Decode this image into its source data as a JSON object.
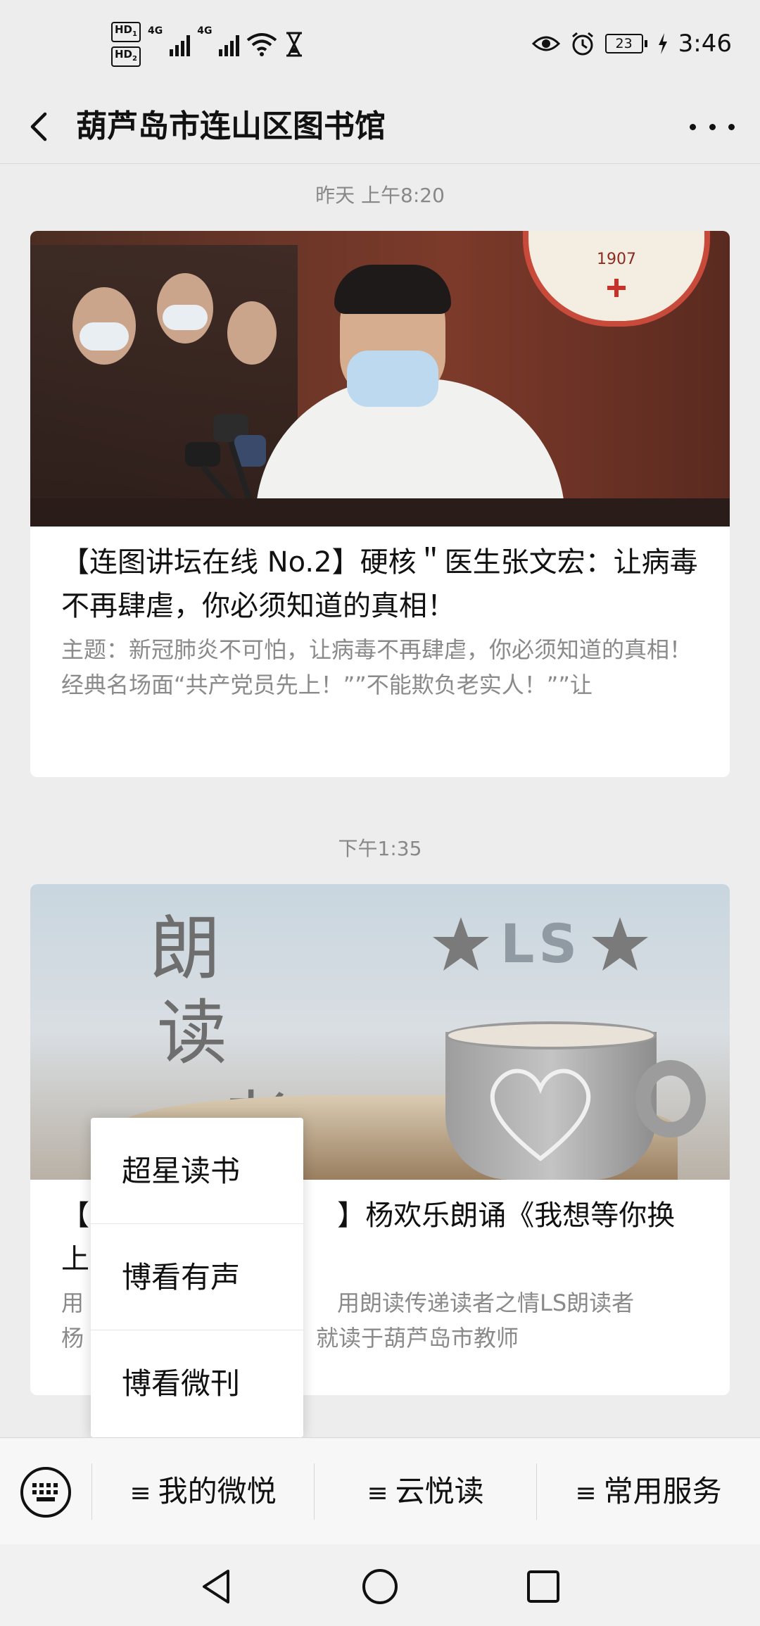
{
  "status_bar": {
    "hd1": "HD",
    "hd1_sub": "1",
    "hd2": "HD",
    "hd2_sub": "2",
    "net1": "4G",
    "net2": "4G",
    "battery": "23",
    "time": "3:46"
  },
  "header": {
    "title": "葫芦岛市连山区图书馆"
  },
  "messages": [
    {
      "time": "昨天 上午8:20",
      "title": "【连图讲坛在线 No.2】硬核＂医生张文宏：让病毒不再肆虐，你必须知道的真相！",
      "desc": "主题：新冠肺炎不可怕，让病毒不再肆虐，你必须知道的真相！经典名场面“共产党员先上！””不能欺负老实人！””让",
      "image_text": "1907"
    },
    {
      "time": "下午1:35",
      "title_left": "【L",
      "title_right": "】杨欢乐朗诵《我想等你换",
      "title_line2": "上",
      "desc_line1_left": "用",
      "desc_line1_right": "用朗读传递读者之情LS朗读者",
      "desc_line2_left": "杨",
      "desc_line2_right": "就读于葫芦岛市教师",
      "image_text": {
        "c1": "朗",
        "c2": "读",
        "c3": "者",
        "ls": "LS"
      }
    }
  ],
  "popup_menu": {
    "items": [
      "超星读书",
      "博看有声",
      "博看微刊"
    ]
  },
  "bottom_menu": {
    "items": [
      "我的微悦",
      "云悦读",
      "常用服务"
    ],
    "prefix": "≡"
  }
}
